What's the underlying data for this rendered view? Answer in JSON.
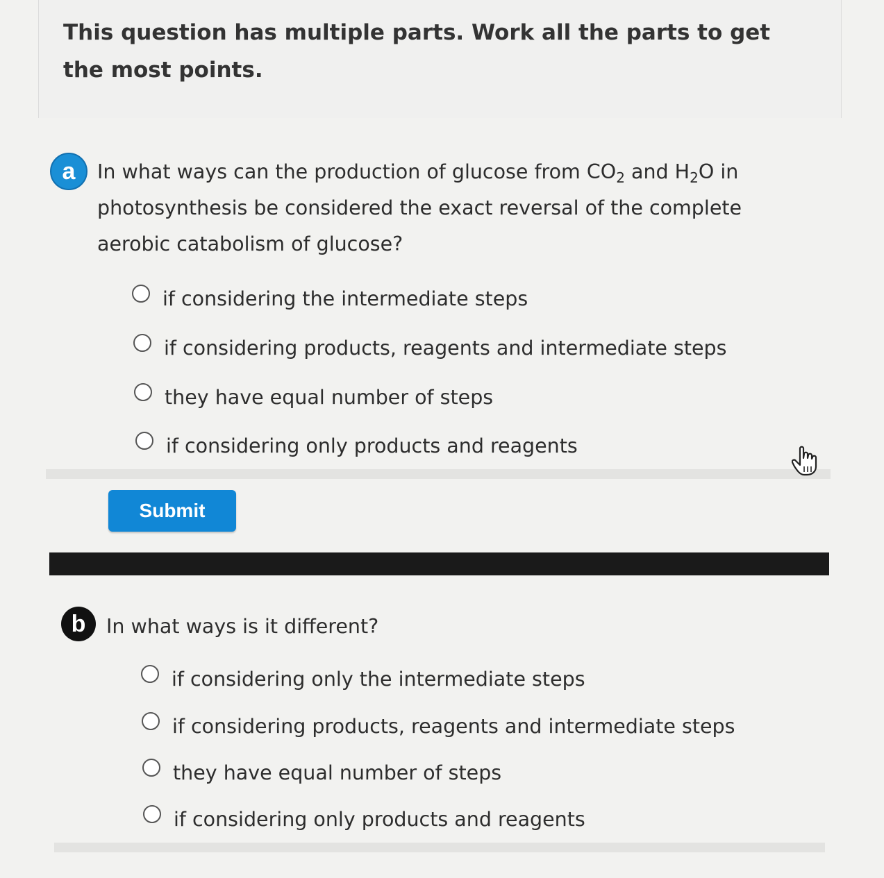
{
  "intro": {
    "text": "This question has multiple parts. Work all the parts to get the most points."
  },
  "part_a": {
    "badge": "a",
    "question_pre": "In what ways can the production of glucose from CO",
    "sub1": "2",
    "question_mid": " and H",
    "sub2": "2",
    "question_post": "O in photosynthesis be considered the exact reversal of the complete aerobic catabolism of glucose?",
    "options": [
      "if considering the intermediate steps",
      "if considering products, reagents and intermediate steps",
      "they have equal number of steps",
      "if considering only products and reagents"
    ],
    "submit_label": "Submit"
  },
  "part_b": {
    "badge": "b",
    "question": "In what ways is it different?",
    "options": [
      "if considering only the intermediate steps",
      "if considering products, reagents and intermediate steps",
      "they have equal number of steps",
      "if considering only products and reagents"
    ]
  },
  "colors": {
    "accent": "#1187d6",
    "badge_a": "#1a8fd6",
    "badge_b": "#111111"
  },
  "icons": {
    "cursor": "hand-pointer-icon"
  }
}
